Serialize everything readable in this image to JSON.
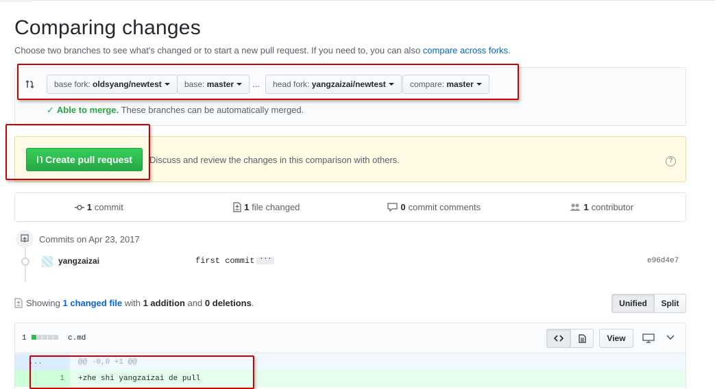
{
  "header": {
    "title": "Comparing changes",
    "subtitle_prefix": "Choose two branches to see what's changed or to start a new pull request. If you need to, you can also ",
    "subtitle_link": "compare across forks",
    "subtitle_suffix": "."
  },
  "range": {
    "base_fork_label": "base fork:",
    "base_fork_value": "oldsyang/newtest",
    "base_label": "base:",
    "base_value": "master",
    "separator": "...",
    "head_fork_label": "head fork:",
    "head_fork_value": "yangzaizai/newtest",
    "compare_label": "compare:",
    "compare_value": "master",
    "merge_status": "Able to merge.",
    "merge_note": "These branches can be automatically merged."
  },
  "flash": {
    "create_button": "Create pull request",
    "text": "Discuss and review the changes in this comparison with others."
  },
  "numbers": {
    "commits_count": "1",
    "commits_label": "commit",
    "files_count": "1",
    "files_label": "file changed",
    "comments_count": "0",
    "comments_label": "commit comments",
    "contributors_count": "1",
    "contributors_label": "contributor"
  },
  "commits": {
    "group_title": "Commits on Apr 23, 2017",
    "items": [
      {
        "author": "yangzaizai",
        "message": "first commit",
        "sha": "e96d4e7"
      }
    ]
  },
  "diff_summary": {
    "showing": "Showing",
    "changed_files": "1 changed file",
    "with": "with",
    "additions": "1 addition",
    "and": "and",
    "deletions": "0 deletions",
    "period": ".",
    "unified_label": "Unified",
    "split_label": "Split"
  },
  "file": {
    "stat_count": "1",
    "name": "c.md",
    "view_label": "View",
    "hunk_dots": "...",
    "hunk_header": "@@ -0,0 +1 @@",
    "lines": [
      {
        "new_num": "1",
        "code": "+zhe shi yangzaizai de pull"
      }
    ]
  },
  "colors": {
    "green_button": "#28a745",
    "link_blue": "#0366d6",
    "annotation_red": "#cc0000"
  }
}
